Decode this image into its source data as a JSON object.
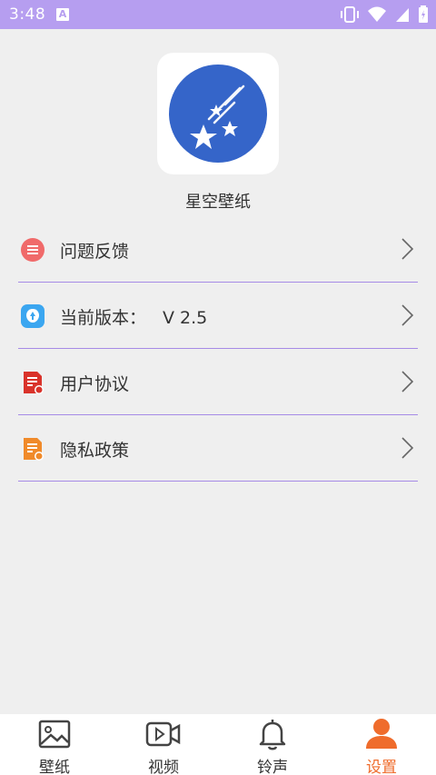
{
  "status_bar": {
    "time": "3:48",
    "notification_glyph": "A",
    "icons": [
      "vibrate-icon",
      "wifi-icon",
      "signal-icon",
      "battery-icon"
    ]
  },
  "app": {
    "name": "星空壁纸",
    "icon": "shooting-stars-icon",
    "icon_color": "#3565c9"
  },
  "menu": {
    "items": [
      {
        "label": "问题反馈",
        "value": "",
        "icon": "feedback-icon",
        "color": "#f06a6a"
      },
      {
        "label": "当前版本：",
        "value": "V 2.5",
        "icon": "version-icon",
        "color": "#3ba6f0"
      },
      {
        "label": "用户协议",
        "value": "",
        "icon": "user-agreement-icon",
        "color": "#d9332b"
      },
      {
        "label": "隐私政策",
        "value": "",
        "icon": "privacy-policy-icon",
        "color": "#f08a2a"
      }
    ]
  },
  "tab_bar": {
    "tabs": [
      {
        "label": "壁纸",
        "icon": "image-icon",
        "active": false
      },
      {
        "label": "视频",
        "icon": "video-icon",
        "active": false
      },
      {
        "label": "铃声",
        "icon": "bell-icon",
        "active": false
      },
      {
        "label": "设置",
        "icon": "person-icon",
        "active": true
      }
    ]
  },
  "colors": {
    "status_bar": "#b69ef0",
    "divider": "#a68be6",
    "active_tab": "#ef6c2c"
  }
}
